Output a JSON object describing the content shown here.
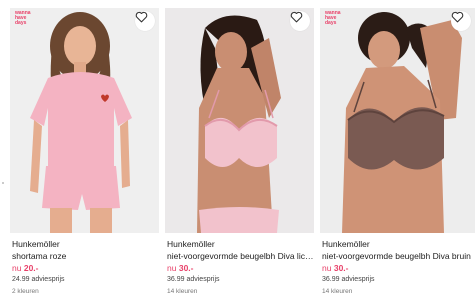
{
  "products": [
    {
      "badge": "wanna have days",
      "brand": "Hunkemöller",
      "name": "shortama roze",
      "price_prefix": "nu",
      "price": "20.-",
      "rrp": "24.99 adviesprijs",
      "colors": "2 kleuren",
      "wishlist_icon": "heart-outline-icon"
    },
    {
      "badge": "",
      "brand": "Hunkemöller",
      "name": "niet-voorgevormde beugelbh Diva lichtr...",
      "price_prefix": "nu",
      "price": "30.-",
      "rrp": "36.99 adviesprijs",
      "colors": "14 kleuren",
      "wishlist_icon": "heart-outline-icon"
    },
    {
      "badge": "wanna have days",
      "brand": "Hunkemöller",
      "name": "niet-voorgevormde beugelbh Diva bruin",
      "price_prefix": "nu",
      "price": "30.-",
      "rrp": "36.99 adviesprijs",
      "colors": "14 kleuren",
      "wishlist_icon": "heart-outline-icon"
    }
  ],
  "colors": {
    "sale": "#e8426a",
    "text": "#222222",
    "muted": "#777777",
    "photo_bg": "#ececec"
  }
}
